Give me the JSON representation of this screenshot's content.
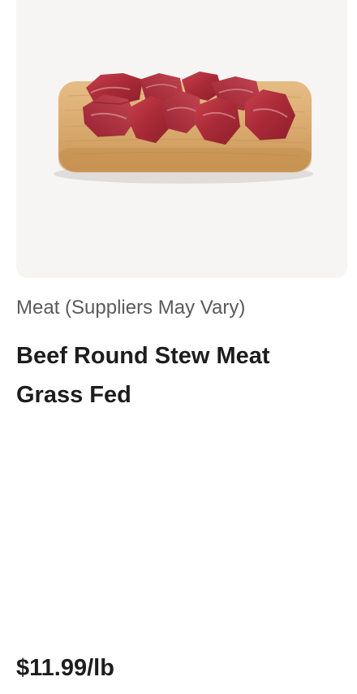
{
  "product": {
    "image_alt": "Beef stew meat cubes on a wooden cutting board",
    "category": "Meat (Suppliers May Vary)",
    "title": "Beef Round Stew Meat Grass Fed",
    "price": "$11.99/lb"
  },
  "colors": {
    "image_background": "#f6f5f4",
    "board": "#d9ab72",
    "meat": "#b5313d",
    "text_primary": "#1d1d1d",
    "text_secondary": "#5a5a5a"
  }
}
